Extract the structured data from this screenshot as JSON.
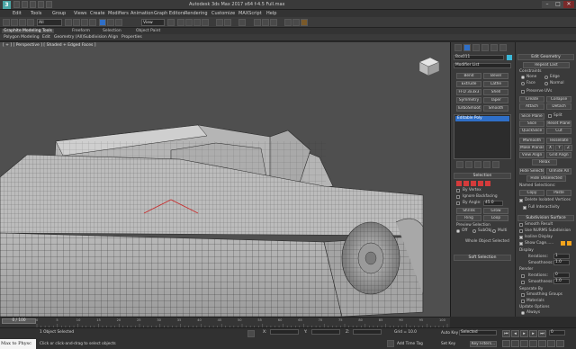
{
  "window": {
    "title": "Autodesk 3ds Max 2017 x64    f-4.5  Full.max",
    "min_glyph": "–",
    "max_glyph": "□",
    "close_glyph": "✕"
  },
  "menu": {
    "items": [
      "Edit",
      "Tools",
      "Group",
      "Views",
      "Create",
      "Modifiers",
      "Animation",
      "Graph Editors",
      "Rendering",
      "Customize",
      "MAXScript",
      "Help"
    ]
  },
  "toolbar": {
    "selection_filter": "All",
    "reference_coord": "View"
  },
  "ribbon": {
    "tabs": [
      "Graphite Modeling Tools",
      "Freeform",
      "Selection",
      "Object Paint"
    ],
    "active_tab": 0,
    "subtabs": [
      "Polygon Modeling",
      "Edit",
      "Geometry (All)",
      "Subdivision",
      "Align",
      "Properties"
    ]
  },
  "viewport": {
    "label": "[ + ] [ Perspective ] [ Shaded + Edged Faces ]"
  },
  "command_panel": {
    "object_name": "Box011",
    "modifier_list_label": "Modifier List",
    "modifier_buttons": [
      "Bend",
      "Bevel",
      "Extrude",
      "Lathe",
      "FFD 3x3x3",
      "Shell",
      "Symmetry",
      "Taper",
      "TurboSmooth",
      "Smooth"
    ],
    "stack_items": [
      "Editable Poly"
    ],
    "selection": {
      "header": "Selection",
      "by_vertex": "By Vertex",
      "ignore_backfacing": "Ignore Backfacing",
      "by_angle": "By Angle:",
      "angle_value": "45.0",
      "shrink": "Shrink",
      "grow": "Grow",
      "ring": "Ring",
      "loop": "Loop",
      "preview_header": "Preview Selection",
      "preview_off": "Off",
      "preview_subobj": "SubObj",
      "preview_multi": "Multi",
      "whole_object": "Whole Object Selected"
    },
    "soft_selection": "Soft Selection"
  },
  "edit_geometry": {
    "header": "Edit Geometry",
    "repeat_last": "Repeat Last",
    "constraints": "Constraints",
    "none": "None",
    "edge": "Edge",
    "face": "Face",
    "normal": "Normal",
    "preserve_uvs": "Preserve UVs",
    "create": "Create",
    "collapse": "Collapse",
    "attach": "Attach",
    "detach": "Detach",
    "slice_plane": "Slice Plane",
    "split": "Split",
    "slice": "Slice",
    "reset_plane": "Reset Plane",
    "quickslice": "QuickSlice",
    "cut": "Cut",
    "msmooth": "MSmooth",
    "tessellate": "Tessellate",
    "make_planar": "Make Planar",
    "x": "X",
    "y": "Y",
    "z": "Z",
    "view_align": "View Align",
    "grid_align": "Grid Align",
    "relax": "Relax",
    "hide_selected": "Hide Selected",
    "unhide_all": "Unhide All",
    "hide_unselected": "Hide Unselected",
    "named_selections": "Named Selections:",
    "copy": "Copy",
    "paste": "Paste",
    "delete_isolated": "Delete Isolated Vertices",
    "full_interactivity": "Full Interactivity"
  },
  "subdivision": {
    "header": "Subdivision Surface",
    "smooth_result": "Smooth Result",
    "use_nurms": "Use NURMS Subdivision",
    "isoline_display": "Isoline Display",
    "show_cage": "Show Cage......",
    "cage_colors": [
      "#f2a31c",
      "#f2a31c"
    ],
    "display": "Display",
    "iterations_label": "Iterations:",
    "iterations_value": "1",
    "smoothness_label": "Smoothness:",
    "smoothness_value": "1.0",
    "render": "Render",
    "r_iterations_value": "0",
    "r_smoothness_value": "1.0",
    "separate_by": "Separate By",
    "smoothing_groups": "Smoothing Groups",
    "materials": "Materials",
    "update_options": "Update Options",
    "always": "Always",
    "when_rendering": "When Rendering",
    "manually": "Manually"
  },
  "timeline": {
    "slider_text": "0 / 100",
    "tick_labels": [
      "0",
      "5",
      "10",
      "15",
      "20",
      "25",
      "30",
      "35",
      "40",
      "45",
      "50",
      "55",
      "60",
      "65",
      "70",
      "75",
      "80",
      "85",
      "90",
      "95",
      "100"
    ]
  },
  "status": {
    "maxscript_mini": "Max to Physc",
    "objects_selected": "1 Object Selected",
    "prompt": "Click or click-and-drag to select objects",
    "x_label": "X:",
    "y_label": "Y:",
    "z_label": "Z:",
    "grid": "Grid = 10.0",
    "add_time_tag": "Add Time Tag",
    "auto_key": "Auto Key",
    "selected": "Selected",
    "set_key": "Set Key",
    "key_filters": "Key Filters...",
    "frame": "0"
  },
  "colors": {
    "accent_blue": "#2f6fc8",
    "mesh_grey": "#bdbdbd",
    "wire": "#232323"
  }
}
